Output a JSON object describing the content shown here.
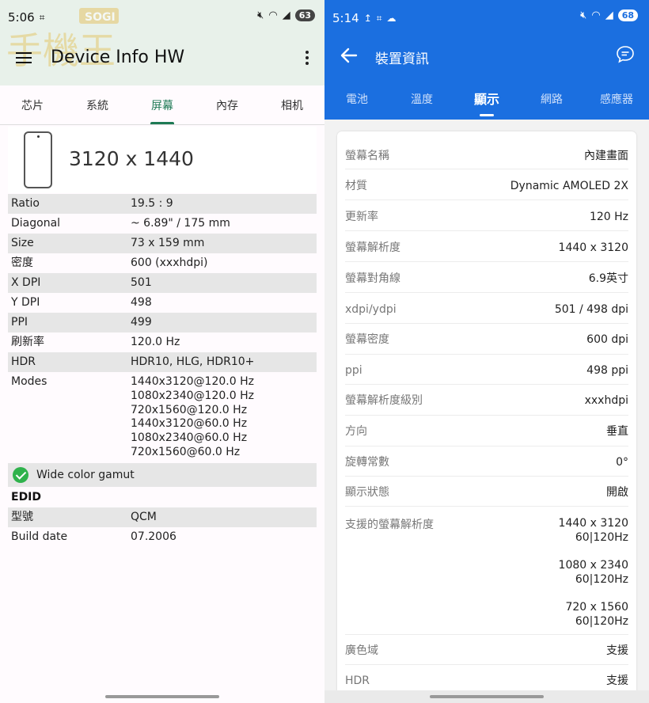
{
  "left": {
    "status": {
      "time": "5:06",
      "battery": "63"
    },
    "watermark": {
      "brand": "SOGI"
    },
    "app_title": "Device Info HW",
    "tabs": [
      {
        "label": "芯片"
      },
      {
        "label": "系統"
      },
      {
        "label": "屏幕",
        "active": true
      },
      {
        "label": "內存"
      },
      {
        "label": "相机"
      }
    ],
    "resolution": "3120 x 1440",
    "rows": [
      {
        "key": "Ratio",
        "value": "19.5 : 9"
      },
      {
        "key": "Diagonal",
        "value": "~ 6.89\" / 175 mm"
      },
      {
        "key": "Size",
        "value": "73 x 159 mm"
      },
      {
        "key": "密度",
        "value": "600 (xxxhdpi)"
      },
      {
        "key": "X DPI",
        "value": "501"
      },
      {
        "key": "Y DPI",
        "value": "498"
      },
      {
        "key": "PPI",
        "value": "499"
      },
      {
        "key": "刷新率",
        "value": "120.0 Hz"
      },
      {
        "key": "HDR",
        "value": "HDR10, HLG, HDR10+"
      }
    ],
    "modes_label": "Modes",
    "modes": [
      "1440x3120@120.0 Hz",
      "1080x2340@120.0 Hz",
      "720x1560@120.0 Hz",
      "1440x3120@60.0 Hz",
      "1080x2340@60.0 Hz",
      "720x1560@60.0 Hz"
    ],
    "wide_color_gamut": "Wide color gamut",
    "edid_header": "EDID",
    "edid_rows": [
      {
        "key": "型號",
        "value": "QCM"
      },
      {
        "key": "Build date",
        "value": "07.2006"
      }
    ],
    "accent_color": "#1e7a55"
  },
  "right": {
    "status": {
      "time": "5:14",
      "battery": "68"
    },
    "title": "裝置資訊",
    "tabs": [
      {
        "label": "電池"
      },
      {
        "label": "溫度"
      },
      {
        "label": "顯示",
        "active": true
      },
      {
        "label": "網路"
      },
      {
        "label": "感應器"
      }
    ],
    "rows": [
      {
        "key": "螢幕名稱",
        "value": "內建畫面"
      },
      {
        "key": "材質",
        "value": "Dynamic AMOLED 2X"
      },
      {
        "key": "更新率",
        "value": "120 Hz"
      },
      {
        "key": "螢幕解析度",
        "value": "1440 x 3120"
      },
      {
        "key": "螢幕對角線",
        "value": "6.9英寸"
      },
      {
        "key": "xdpi/ydpi",
        "value": "501 / 498 dpi"
      },
      {
        "key": "螢幕密度",
        "value": "600 dpi"
      },
      {
        "key": "ppi",
        "value": "498 ppi"
      },
      {
        "key": "螢幕解析度級別",
        "value": "xxxhdpi"
      },
      {
        "key": "方向",
        "value": "垂直"
      },
      {
        "key": "旋轉常數",
        "value": "0°"
      },
      {
        "key": "顯示狀態",
        "value": "開啟"
      }
    ],
    "supported_label": "支援的螢幕解析度",
    "supported": [
      {
        "res": "1440 x 3120",
        "hz": "60|120Hz"
      },
      {
        "res": "1080 x 2340",
        "hz": "60|120Hz"
      },
      {
        "res": "720 x 1560",
        "hz": "60|120Hz"
      }
    ],
    "tail_rows": [
      {
        "key": "廣色域",
        "value": "支援"
      },
      {
        "key": "HDR",
        "value": "支援"
      }
    ],
    "accent_color": "#1b6fe0"
  }
}
